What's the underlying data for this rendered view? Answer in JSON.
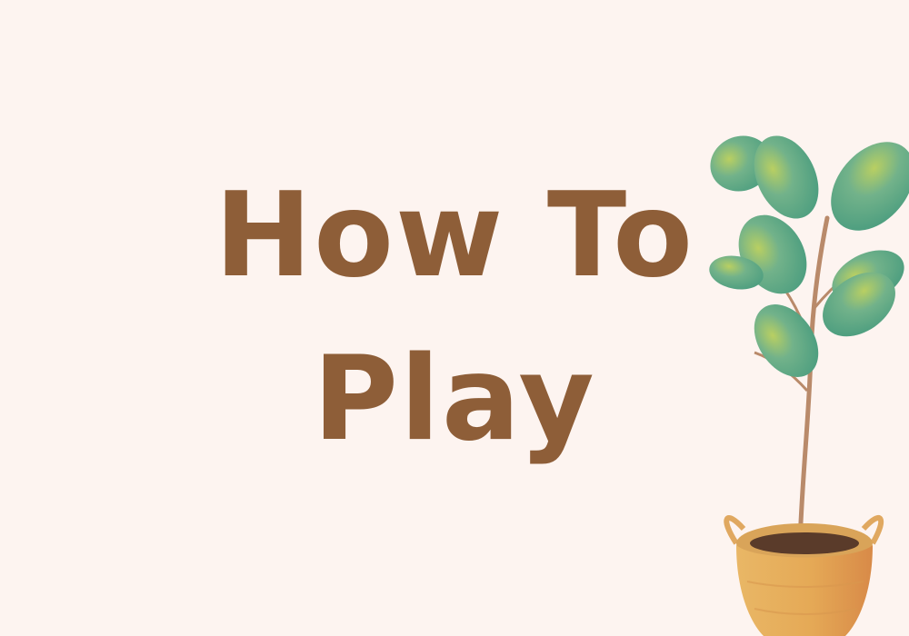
{
  "heading": {
    "line1": "How To",
    "line2": "Play"
  },
  "colors": {
    "background": "#fdf4f0",
    "heading": "#8e5e38",
    "leaf": "#5fae8c",
    "leaf_highlight": "#b9cf62",
    "stem": "#b98a6a",
    "pot": "#e7ad5a",
    "pot_shadow": "#d98e4a",
    "soil": "#5a3b2a"
  },
  "illustration": {
    "icon": "potted-fiddle-leaf-plant-icon"
  }
}
